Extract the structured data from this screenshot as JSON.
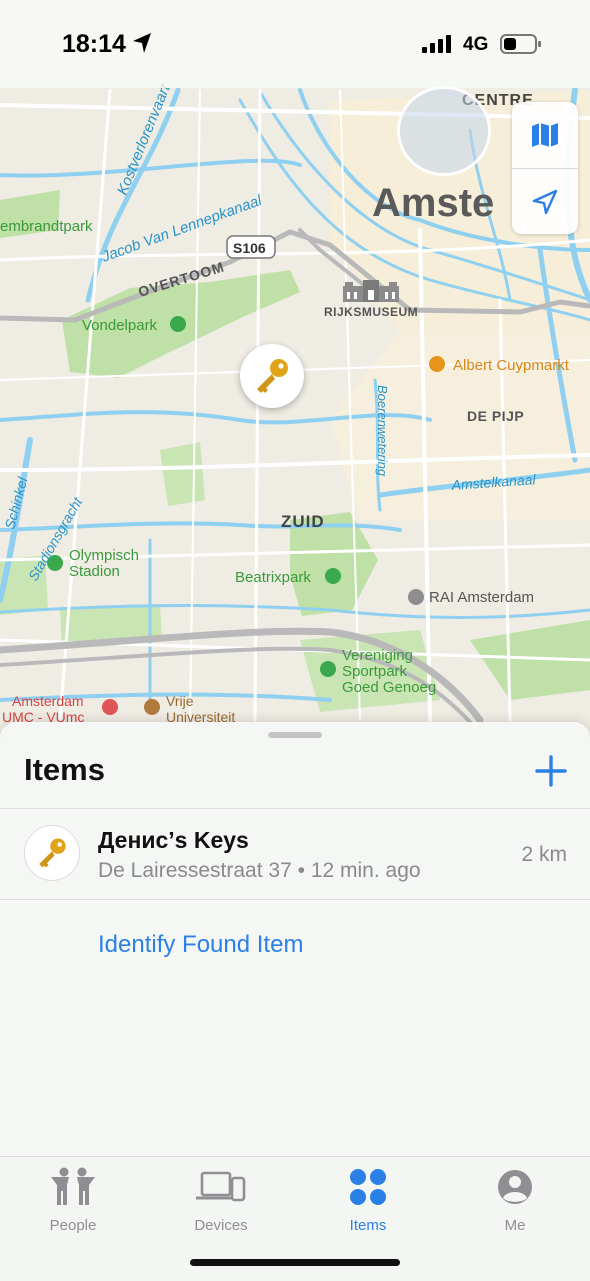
{
  "status_bar": {
    "time": "18:14",
    "network": "4G"
  },
  "map": {
    "labels": {
      "centre": "CENTRE",
      "amsterdam": "Amste",
      "kostverlorenvaart": "Kostverlorenvaart",
      "rembrandtpark": "embrandtpark",
      "jacob_van_lennepkanaal": "Jacob Van Lennepkanaal",
      "route": "S106",
      "overtoom": "OVERTOOM",
      "rijksmuseum": "RIJKSMUSEUM",
      "vondelpark": "Vondelpark",
      "albert_cuypmarkt": "Albert Cuypmarkt",
      "de_pijp": "DE PIJP",
      "boerenwetering": "Boerenwetering",
      "amstelkanaal": "Amstelkanaal",
      "schinkel": "Schinkel",
      "stadionsgracht": "Stadionsgracht",
      "zuid": "ZUID",
      "olympisch": "Olympisch",
      "stadion": "Stadion",
      "beatrixpark": "Beatrixpark",
      "rai_amsterdam": "RAI Amsterdam",
      "vereniging": "Vereniging",
      "sportpark": "Sportpark",
      "goed_genoeg": "Goed Genoeg",
      "amsterdam_umc_1": "Amsterdam",
      "amsterdam_umc_2": "UMC - VUmc",
      "vrije": "Vrije",
      "universiteit": "Universiteit"
    },
    "buttons": {
      "map_mode_icon": "map-icon",
      "location_icon": "location-arrow-icon"
    },
    "pin_icon": "key-icon"
  },
  "sheet": {
    "title": "Items",
    "add_icon": "plus-icon",
    "items": [
      {
        "name": "Денис’s Keys",
        "address": "De Lairessestraat 37",
        "time_ago": "12 min. ago",
        "distance": "2 km",
        "icon": "key-icon"
      }
    ],
    "identify_label": "Identify Found Item"
  },
  "tab_bar": {
    "tabs": [
      {
        "label": "People",
        "icon": "people-icon",
        "active": false
      },
      {
        "label": "Devices",
        "icon": "devices-icon",
        "active": false
      },
      {
        "label": "Items",
        "icon": "items-icon",
        "active": true
      },
      {
        "label": "Me",
        "icon": "person-icon",
        "active": false
      }
    ]
  },
  "colors": {
    "accent": "#2b80e8",
    "water": "#8fd0f0",
    "park": "#bfe0a6",
    "poi_green": "#3aa84c",
    "poi_orange": "#e7941a",
    "key": "#e1a418"
  }
}
